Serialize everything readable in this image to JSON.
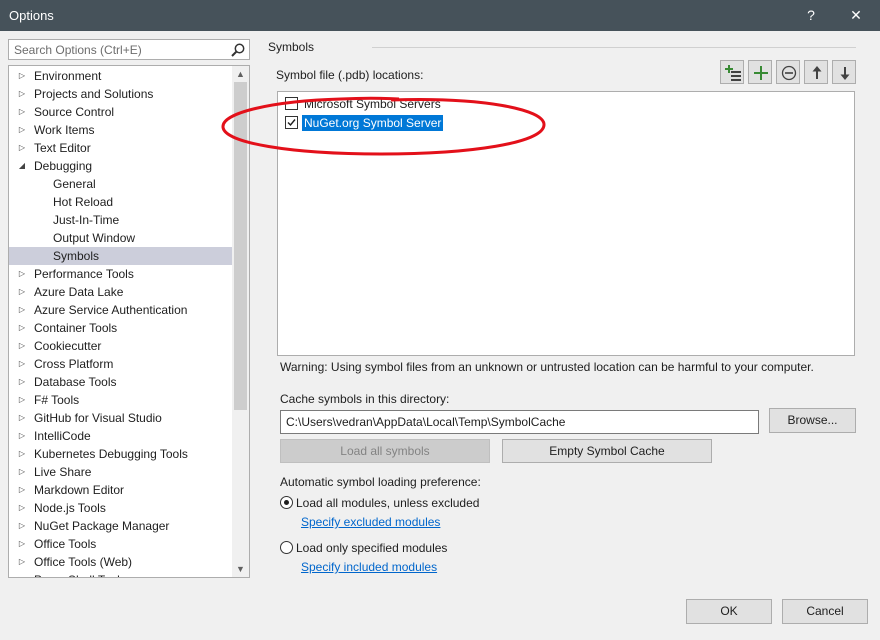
{
  "window": {
    "title": "Options",
    "help_label": "?",
    "close_label": "✕"
  },
  "search": {
    "placeholder": "Search Options (Ctrl+E)"
  },
  "tree": {
    "items": [
      {
        "label": "Environment",
        "state": "collapsed"
      },
      {
        "label": "Projects and Solutions",
        "state": "collapsed"
      },
      {
        "label": "Source Control",
        "state": "collapsed"
      },
      {
        "label": "Work Items",
        "state": "collapsed"
      },
      {
        "label": "Text Editor",
        "state": "collapsed"
      },
      {
        "label": "Debugging",
        "state": "expanded"
      },
      {
        "label": "General",
        "state": "child"
      },
      {
        "label": "Hot Reload",
        "state": "child"
      },
      {
        "label": "Just-In-Time",
        "state": "child"
      },
      {
        "label": "Output Window",
        "state": "child"
      },
      {
        "label": "Symbols",
        "state": "child-selected"
      },
      {
        "label": "Performance Tools",
        "state": "collapsed"
      },
      {
        "label": "Azure Data Lake",
        "state": "collapsed"
      },
      {
        "label": "Azure Service Authentication",
        "state": "collapsed"
      },
      {
        "label": "Container Tools",
        "state": "collapsed"
      },
      {
        "label": "Cookiecutter",
        "state": "collapsed"
      },
      {
        "label": "Cross Platform",
        "state": "collapsed"
      },
      {
        "label": "Database Tools",
        "state": "collapsed"
      },
      {
        "label": "F# Tools",
        "state": "collapsed"
      },
      {
        "label": "GitHub for Visual Studio",
        "state": "collapsed"
      },
      {
        "label": "IntelliCode",
        "state": "collapsed"
      },
      {
        "label": "Kubernetes Debugging Tools",
        "state": "collapsed"
      },
      {
        "label": "Live Share",
        "state": "collapsed"
      },
      {
        "label": "Markdown Editor",
        "state": "collapsed"
      },
      {
        "label": "Node.js Tools",
        "state": "collapsed"
      },
      {
        "label": "NuGet Package Manager",
        "state": "collapsed"
      },
      {
        "label": "Office Tools",
        "state": "collapsed"
      },
      {
        "label": "Office Tools (Web)",
        "state": "collapsed"
      },
      {
        "label": "PowerShell Tools",
        "state": "collapsed"
      }
    ]
  },
  "symbols": {
    "section_title": "Symbols",
    "locations_label": "Symbol file (.pdb) locations:",
    "toolbar_icons": [
      "add-location-icon",
      "add-icon",
      "remove-icon",
      "move-up-icon",
      "move-down-icon"
    ],
    "locations": [
      {
        "label": "Microsoft Symbol Servers",
        "checked": false,
        "selected": false
      },
      {
        "label": "NuGet.org Symbol Server",
        "checked": true,
        "selected": true
      }
    ],
    "warning": "Warning: Using symbol files from an unknown or untrusted location can be harmful to your computer.",
    "cache_label": "Cache symbols in this directory:",
    "cache_path": "C:\\Users\\vedran\\AppData\\Local\\Temp\\SymbolCache",
    "browse_label": "Browse...",
    "load_all_label": "Load all symbols",
    "empty_cache_label": "Empty Symbol Cache",
    "preference_label": "Automatic symbol loading preference:",
    "option_all_label": "Load all modules, unless excluded",
    "option_all_link": "Specify excluded modules",
    "option_only_label": "Load only specified modules",
    "option_only_link": "Specify included modules",
    "selected_option": "all"
  },
  "annotation": {
    "shape": "ellipse",
    "color": "#e3101a"
  },
  "footer": {
    "ok_label": "OK",
    "cancel_label": "Cancel"
  },
  "colors": {
    "titlebar": "#46525a",
    "selection": "#0078d7",
    "tree_selection": "#cccedb",
    "link": "#0066cc",
    "add_green": "#388a34"
  }
}
